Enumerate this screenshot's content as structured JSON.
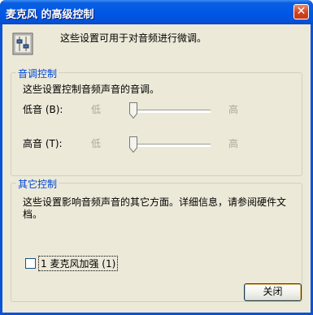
{
  "window": {
    "title": "麦克风 的高级控制",
    "close_glyph": "✕"
  },
  "intro": {
    "text": "这些设置可用于对音频进行微调。"
  },
  "tone_group": {
    "legend": "音调控制",
    "description": "这些设置控制音频声音的音调。",
    "bass": {
      "label": "低音 (B):",
      "low": "低",
      "high": "高",
      "level": 0.0
    },
    "treble": {
      "label": "高音 (T):",
      "low": "低",
      "high": "高",
      "level": 0.0
    }
  },
  "other_group": {
    "legend": "其它控制",
    "description_line1": "这些设置影响音频声音的其它方面。详细信息，请参阅硬件文",
    "description_line2": "档。",
    "checkbox": {
      "label": "1  麦克风加强 (1)",
      "checked": false
    }
  },
  "buttons": {
    "close": "关闭"
  },
  "colors": {
    "accent": "#0046d5",
    "titlebar": "#0058e6",
    "client_bg": "#ece9d8"
  }
}
